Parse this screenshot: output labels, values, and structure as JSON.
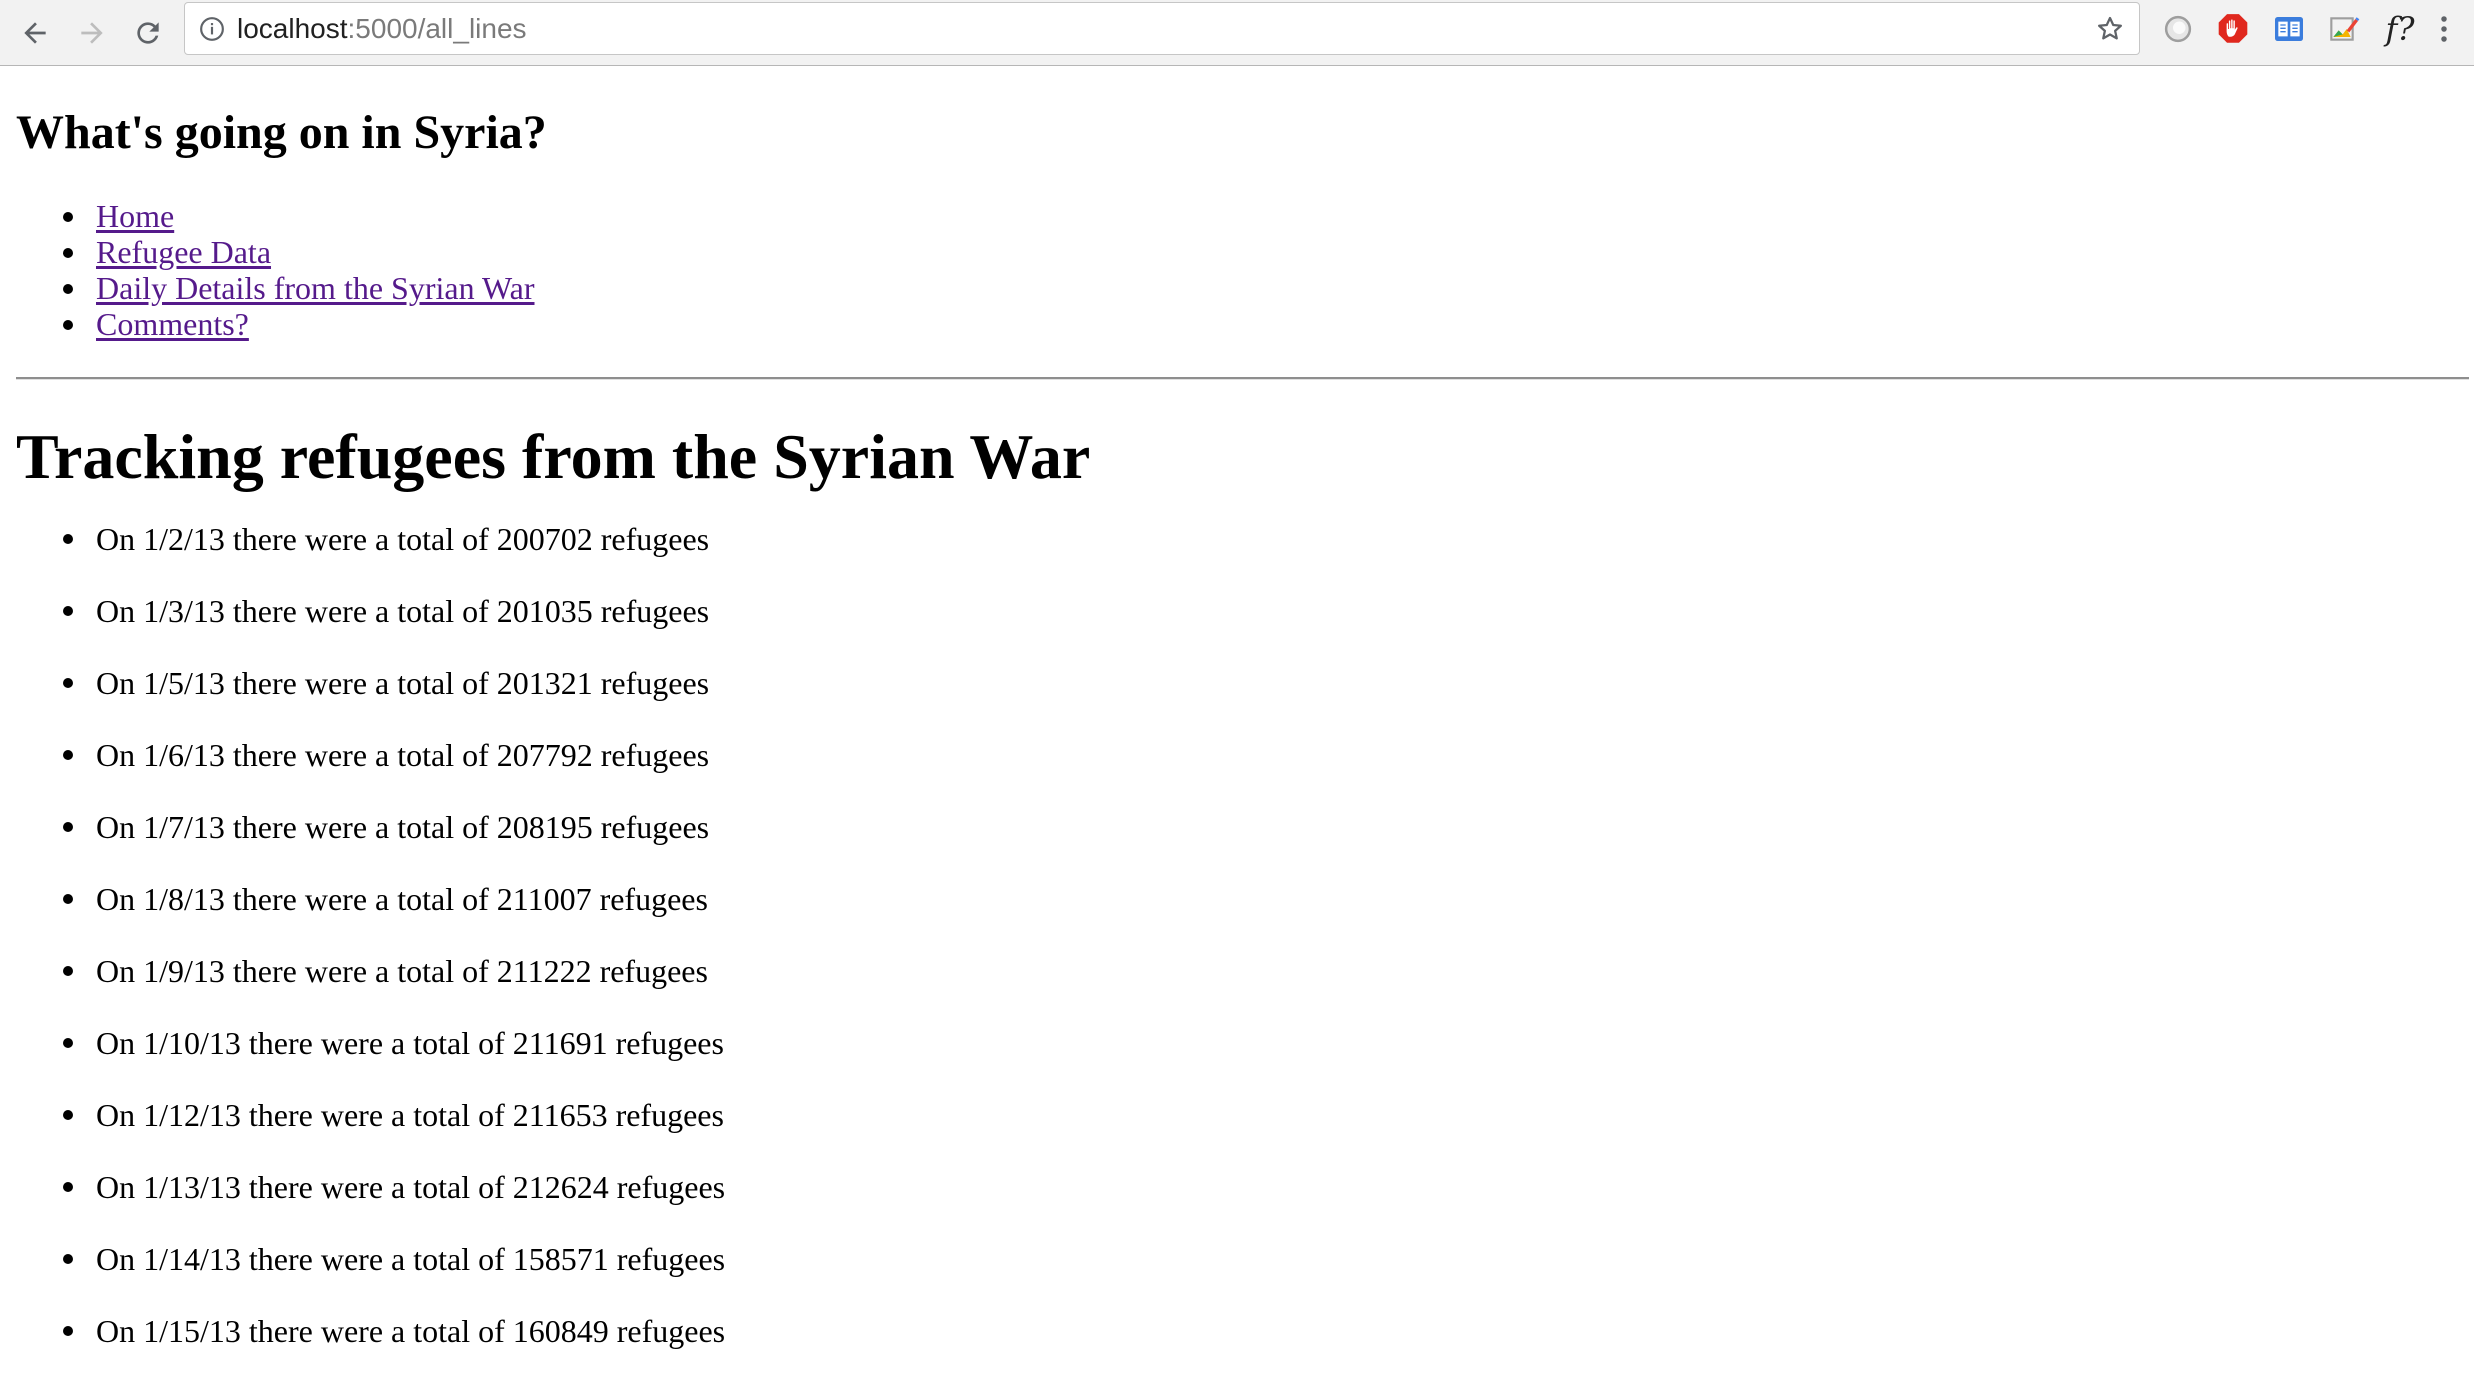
{
  "browser": {
    "url_host": "localhost",
    "url_path": ":5000/all_lines"
  },
  "site": {
    "title": "What's going on in Syria?",
    "nav": [
      {
        "label": "Home"
      },
      {
        "label": "Refugee Data"
      },
      {
        "label": "Daily Details from the Syrian War"
      },
      {
        "label": "Comments?"
      }
    ]
  },
  "main": {
    "title": "Tracking refugees from the Syrian War",
    "entries": [
      {
        "text": "On 1/2/13 there were a total of 200702 refugees"
      },
      {
        "text": "On 1/3/13 there were a total of 201035 refugees"
      },
      {
        "text": "On 1/5/13 there were a total of 201321 refugees"
      },
      {
        "text": "On 1/6/13 there were a total of 207792 refugees"
      },
      {
        "text": "On 1/7/13 there were a total of 208195 refugees"
      },
      {
        "text": "On 1/8/13 there were a total of 211007 refugees"
      },
      {
        "text": "On 1/9/13 there were a total of 211222 refugees"
      },
      {
        "text": "On 1/10/13 there were a total of 211691 refugees"
      },
      {
        "text": "On 1/12/13 there were a total of 211653 refugees"
      },
      {
        "text": "On 1/13/13 there were a total of 212624 refugees"
      },
      {
        "text": "On 1/14/13 there were a total of 158571 refugees"
      },
      {
        "text": "On 1/15/13 there were a total of 160849 refugees"
      }
    ]
  },
  "extensions": {
    "fx_label": "f?"
  },
  "icons": {
    "back": "arrow-left-icon",
    "forward": "arrow-right-icon",
    "reload": "reload-icon",
    "info": "info-icon",
    "bookmark": "star-icon",
    "menu": "kebab-menu-icon"
  },
  "colors": {
    "link_visited": "#551a8b",
    "chrome_bg": "#f2f2f2"
  }
}
